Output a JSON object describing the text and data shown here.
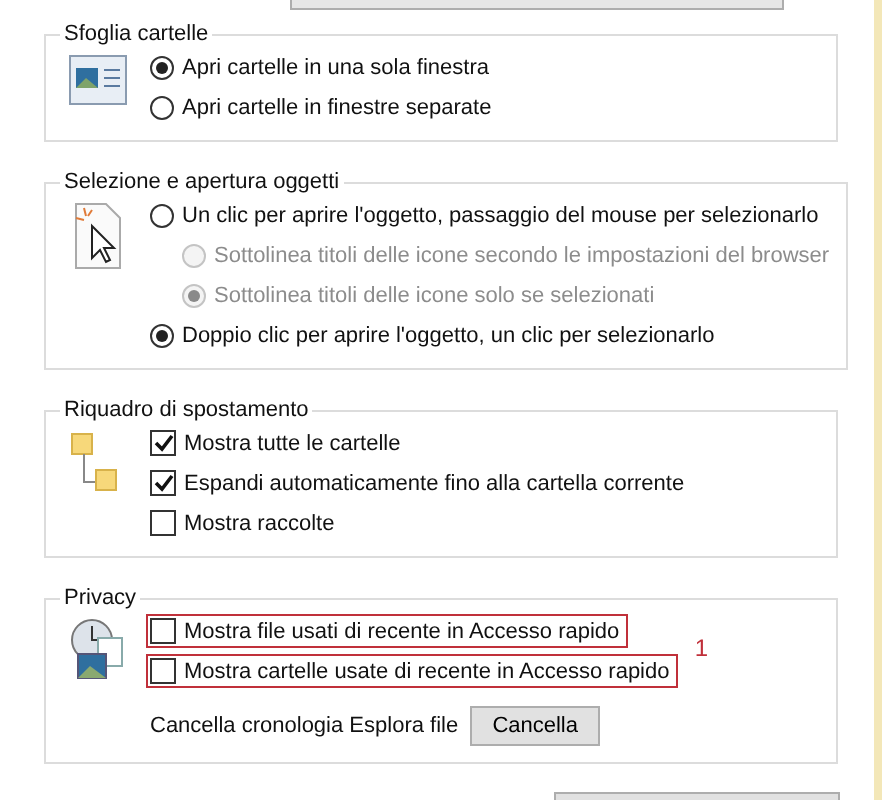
{
  "groups": [
    {
      "title": "Sfoglia cartelle",
      "kind": "browse",
      "options": [
        {
          "kind": "radio",
          "label": "Apri cartelle in una sola finestra",
          "selected": true,
          "disabled": false
        },
        {
          "kind": "radio",
          "label": "Apri cartelle in finestre separate",
          "selected": false,
          "disabled": false
        }
      ]
    },
    {
      "title": "Selezione e apertura oggetti",
      "kind": "click",
      "options": [
        {
          "kind": "radio",
          "label": "Un clic per aprire l'oggetto, passaggio del mouse per selezionarlo",
          "selected": false,
          "disabled": false,
          "children": [
            {
              "kind": "radio",
              "label": "Sottolinea titoli delle icone secondo le impostazioni del browser",
              "selected": false,
              "disabled": true
            },
            {
              "kind": "radio",
              "label": "Sottolinea titoli delle icone solo se selezionati",
              "selected": true,
              "disabled": true
            }
          ]
        },
        {
          "kind": "radio",
          "label": "Doppio clic per aprire l'oggetto, un clic per selezionarlo",
          "selected": true,
          "disabled": false
        }
      ]
    },
    {
      "title": "Riquadro di spostamento",
      "kind": "nav",
      "options": [
        {
          "kind": "checkbox",
          "label": "Mostra tutte le cartelle",
          "checked": true
        },
        {
          "kind": "checkbox",
          "label": "Espandi automaticamente fino alla cartella corrente",
          "checked": true
        },
        {
          "kind": "checkbox",
          "label": "Mostra raccolte",
          "checked": false
        }
      ]
    },
    {
      "title": "Privacy",
      "kind": "privacy",
      "annotation": "1",
      "options": [
        {
          "kind": "checkbox",
          "label": "Mostra file usati di recente in Accesso rapido",
          "checked": false,
          "highlighted": true
        },
        {
          "kind": "checkbox",
          "label": "Mostra cartelle usate di recente in Accesso rapido",
          "checked": false,
          "highlighted": true
        }
      ],
      "clear": {
        "label": "Cancella cronologia Esplora file",
        "button": "Cancella"
      }
    }
  ]
}
